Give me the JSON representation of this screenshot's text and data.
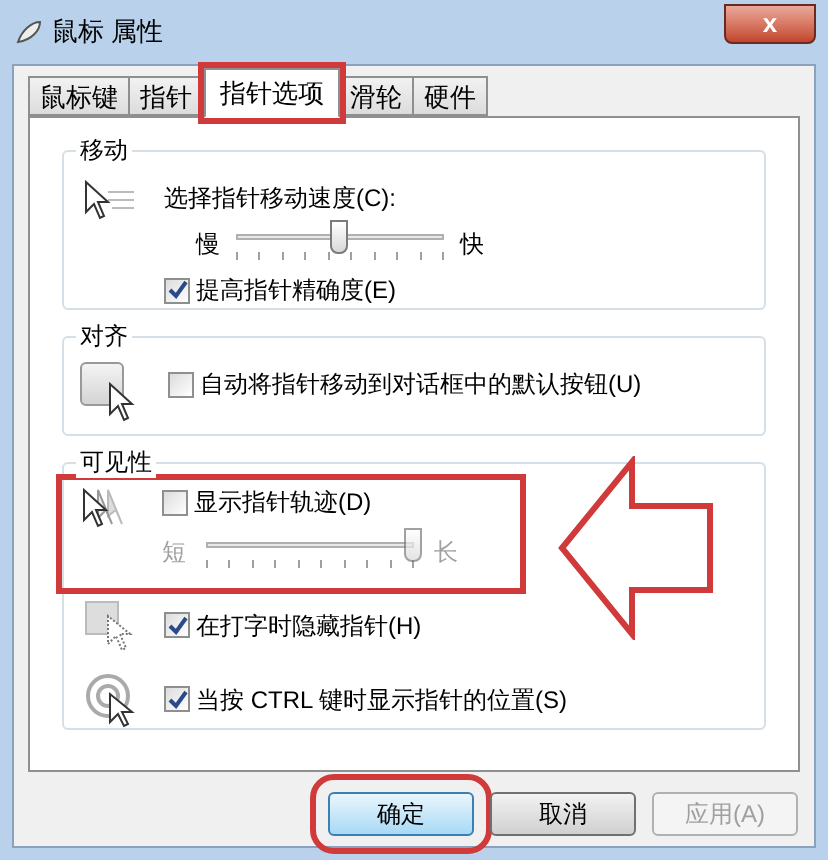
{
  "window": {
    "title": "鼠标 属性",
    "close": "x"
  },
  "tabs": [
    {
      "label": "鼠标键",
      "selected": false,
      "highlighted": false
    },
    {
      "label": "指针",
      "selected": false,
      "highlighted": false
    },
    {
      "label": "指针选项",
      "selected": true,
      "highlighted": true
    },
    {
      "label": "滑轮",
      "selected": false,
      "highlighted": false
    },
    {
      "label": "硬件",
      "selected": false,
      "highlighted": false
    }
  ],
  "motion": {
    "title": "移动",
    "label": "选择指针移动速度(C):",
    "min_label": "慢",
    "max_label": "快",
    "level": 0.5,
    "precision": {
      "label": "提高指针精确度(E)",
      "checked": true
    }
  },
  "snap": {
    "title": "对齐",
    "option": {
      "label": "自动将指针移动到对话框中的默认按钮(U)",
      "checked": false
    }
  },
  "visibility": {
    "title": "可见性",
    "trails": {
      "label": "显示指针轨迹(D)",
      "checked": false,
      "min_label": "短",
      "max_label": "长",
      "level": 1,
      "disabled": true,
      "highlighted": true
    },
    "options": [
      {
        "kind": "hide",
        "label": "在打字时隐藏指针(H)",
        "checked": true
      },
      {
        "kind": "ctrl",
        "label": "当按 CTRL 键时显示指针的位置(S)",
        "checked": true
      }
    ]
  },
  "buttons": [
    {
      "label": "确定",
      "default": true,
      "disabled": false,
      "highlighted": true
    },
    {
      "label": "取消",
      "default": false,
      "disabled": false,
      "highlighted": false
    },
    {
      "label": "应用(A)",
      "default": false,
      "disabled": true,
      "highlighted": false
    }
  ],
  "pointer_arrow": true
}
